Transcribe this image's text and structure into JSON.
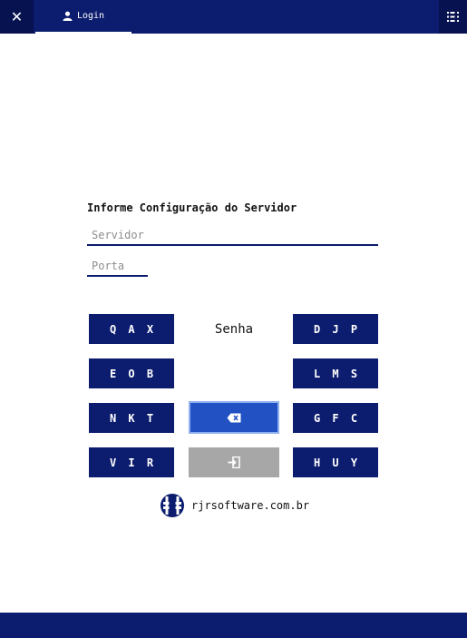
{
  "header": {
    "close_icon": "close-icon",
    "tab_label": "Login",
    "tab_icon": "user-icon",
    "menu_icon": "list-menu-icon"
  },
  "form": {
    "title": "Informe Configuração do Servidor",
    "server_placeholder": "Servidor",
    "server_value": "",
    "port_placeholder": "Porta",
    "port_value": ""
  },
  "keypad": {
    "password_label": "Senha",
    "left_keys": [
      "Q A X",
      "E O B",
      "N K T",
      "V I R"
    ],
    "right_keys": [
      "D J P",
      "L M S",
      "G F C",
      "H U Y"
    ],
    "backspace_icon": "backspace-icon",
    "enter_icon": "login-enter-icon"
  },
  "footer": {
    "brand_text": "rjrsoftware.com.br",
    "logo": "rjr-logo"
  },
  "colors": {
    "primary": "#0c1c6e",
    "accent": "#2251c4",
    "disabled": "#a7a7a7"
  }
}
